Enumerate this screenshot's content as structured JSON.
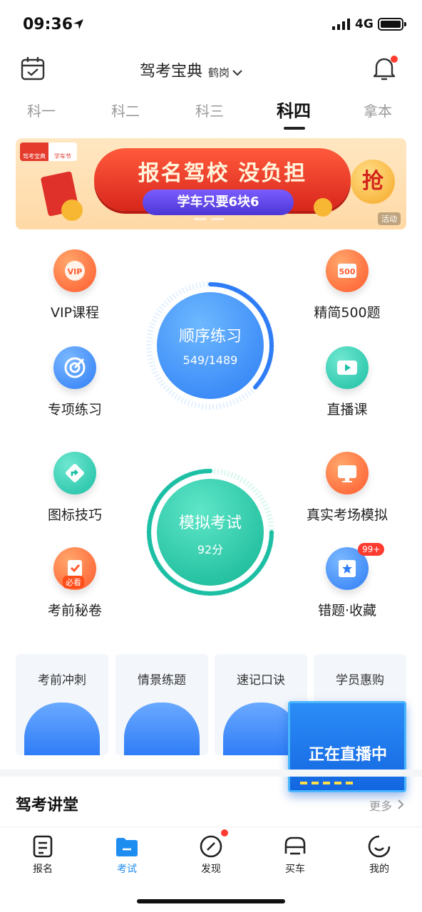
{
  "status": {
    "time": "09:36",
    "network": "4G"
  },
  "header": {
    "title": "驾考宝典",
    "city": "鹤岗"
  },
  "tabs": [
    "科一",
    "科二",
    "科三",
    "科四",
    "拿本"
  ],
  "banner": {
    "headline": "报名驾校 没负担",
    "sub": "学车只要6块6",
    "grab": "抢",
    "tag": "活动",
    "logo_left": "驾考宝典",
    "logo_right": "学车节"
  },
  "features": {
    "vip": "VIP课程",
    "jingjian": "精简500题",
    "zhuanxiang": "专项练习",
    "zhibo": "直播课",
    "tubiao": "图标技巧",
    "zhenshi": "真实考场模拟",
    "kaoqian": "考前秘卷",
    "cuoti": "错题·收藏",
    "icon_500": "500",
    "badge_vip": "VIP",
    "must_see": "必看",
    "badge99": "99+"
  },
  "practice": {
    "title": "顺序练习",
    "progress": "549/1489",
    "fraction": 0.369
  },
  "exam": {
    "title": "模拟考试",
    "score": "92分"
  },
  "cards": [
    "考前冲刺",
    "情景练题",
    "速记口诀",
    "学员惠购"
  ],
  "live": "正在直播中",
  "section": {
    "title": "驾考讲堂",
    "more": "更多"
  },
  "nav": [
    "报名",
    "考试",
    "发现",
    "买车",
    "我的"
  ],
  "colors": {
    "accent": "#1e8df0",
    "orange": "#ff5b2e",
    "teal": "#1cbfa4",
    "red": "#ff3b30"
  }
}
